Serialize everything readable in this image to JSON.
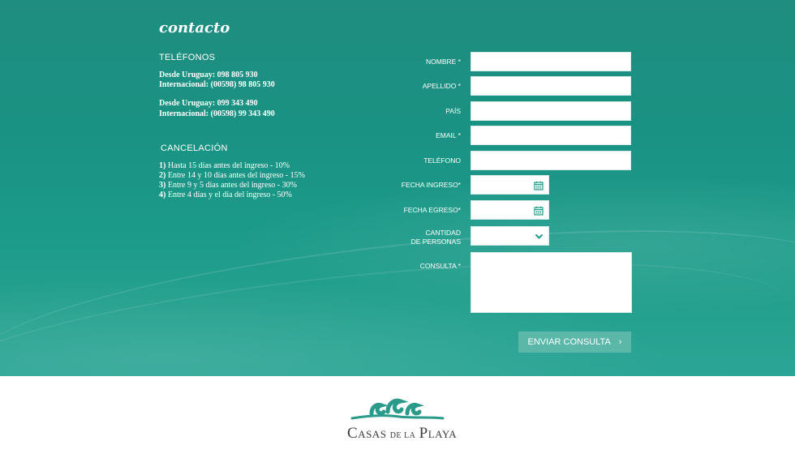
{
  "contact": {
    "title": "contacto",
    "telefonos_heading": "TELÉFONOS",
    "phone_lines": [
      "Desde Uruguay: 098 805 930",
      "Internacional: (00598) 98 805 930",
      "Desde Uruguay: 099 343 490",
      "Internacional: (00598) 99 343 490"
    ],
    "cancelacion_heading": "CANCELACIÓN",
    "cancel_items": [
      {
        "num": "1)",
        "text": "Hasta 15 días antes del ingreso - 10%"
      },
      {
        "num": "2)",
        "text": "Entre 14 y 10 días antes del ingreso - 15%"
      },
      {
        "num": "3)",
        "text": "Entre 9 y 5 días antes del ingreso - 30%"
      },
      {
        "num": "4)",
        "text": "Entre 4 días y el día del ingreso - 50%"
      }
    ]
  },
  "form": {
    "nombre_label": "NOMBRE *",
    "nombre_value": "",
    "apellido_label": "APELLIDO *",
    "apellido_value": "",
    "pais_label": "PAÍS",
    "pais_value": "",
    "email_label": "EMAIL *",
    "email_value": "",
    "telefono_label": "TELÉFONO",
    "telefono_value": "",
    "fecha_ingreso_label": "FECHA INGRESO*",
    "fecha_ingreso_value": "",
    "fecha_egreso_label": "FECHA EGRESO*",
    "fecha_egreso_value": "",
    "cantidad_label_1": "CANTIDAD",
    "cantidad_label_2": "DE PERSONAS",
    "cantidad_value": "",
    "consulta_label": "CONSULTA *",
    "consulta_value": "",
    "submit_label": "ENVIAR CONSULTA",
    "submit_arrow": "›"
  },
  "icons": {
    "calendar": "calendar-icon",
    "dropdown": "chevron-down-icon",
    "submit_arrow": "chevron-right-icon",
    "logo_waves": "waves-logo-icon"
  },
  "footer": {
    "logo_text": "Casas de la Playa",
    "logo_display": "CASAS DE LA PLAYA"
  },
  "colors": {
    "accent": "#23998a",
    "button": "#5bb8a9",
    "logo_wave": "#2a9a8a",
    "logo_text": "#3c3c3c"
  }
}
